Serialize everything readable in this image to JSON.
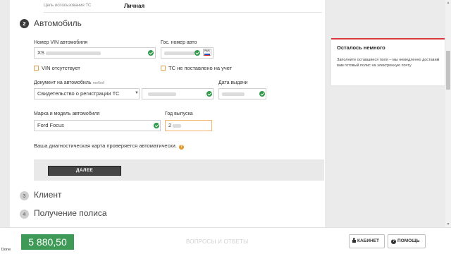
{
  "top": {
    "label": "Цель использования ТС",
    "value": "Личная"
  },
  "steps": [
    {
      "number": "2",
      "title": "Автомобиль"
    },
    {
      "number": "3",
      "title": "Клиент"
    },
    {
      "number": "4",
      "title": "Получение полиса"
    }
  ],
  "vehicle": {
    "vin_label": "Номер VIN автомобиля",
    "vin_value": "XS",
    "vin_checkbox": "VIN отсутствует",
    "plate_label": "Гос. номер авто",
    "plate_flag": "RUS",
    "plate_checkbox": "ТС не поставлено на учет",
    "doc_label": "Документ на автомобиль",
    "doc_hint": "любой",
    "doc_type_value": "Свидетельство о регистрации ТС",
    "issue_date_label": "Дата выдачи",
    "model_label": "Марка и модель автомобиля",
    "model_value": "Ford Focus",
    "year_label": "Год выпуска",
    "year_value": "2",
    "diag_text": "Ваша диагностическая карта проверяется автоматически.",
    "next_button": "ДАЛЕЕ"
  },
  "side_card": {
    "title": "Осталось немного",
    "text": "Заполните оставшиеся поля – мы немедленно доставим вам готовый полис на электронную почту"
  },
  "bottom": {
    "price": "5 880,50",
    "faq": "ВОПРОСЫ И ОТВЕТЫ",
    "cabinet": "КАБИНЕТ",
    "help": "ПОМОЩЬ"
  },
  "status": "Done",
  "colors": {
    "accent_green": "#3f9a57",
    "check_green": "#2f9a4a",
    "alert_red": "#d9383a",
    "checkbox_orange": "#e0a14f"
  }
}
